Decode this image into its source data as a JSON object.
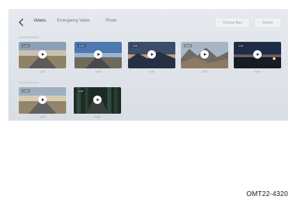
{
  "header": {
    "tabs": [
      {
        "label": "Videos",
        "active": true
      },
      {
        "label": "Emergency Video",
        "active": false
      },
      {
        "label": "Photo",
        "active": false
      }
    ],
    "select_label": "Choose files",
    "delete_label": "Delete"
  },
  "videos": [
    {
      "duration": "1:00",
      "date": "2:00"
    },
    {
      "duration": "1:00",
      "date": "2:00"
    },
    {
      "duration": "1:00",
      "date": "2:00"
    },
    {
      "duration": "1:00",
      "date": "2:00"
    },
    {
      "duration": "1:00",
      "date": "2:00"
    },
    {
      "duration": "1:00",
      "date": "2:00"
    },
    {
      "duration": "1:00",
      "date": "2:00"
    }
  ],
  "figure_id": "OMT22-4320",
  "colors": {
    "accent": "#2f3540",
    "panel_bg": "#e2e6eb"
  }
}
